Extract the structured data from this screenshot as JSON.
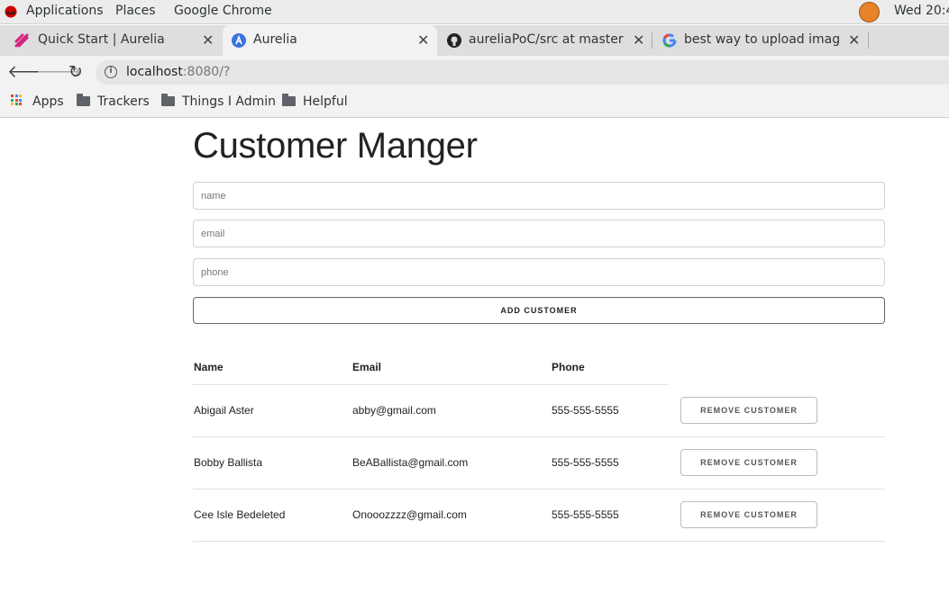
{
  "system": {
    "menus": [
      "Applications",
      "Places",
      "Google Chrome"
    ],
    "clock": "Wed 20:4"
  },
  "browser": {
    "tabs": [
      {
        "title": "Quick Start | Aurelia",
        "active": false
      },
      {
        "title": "Aurelia",
        "active": true
      },
      {
        "title": "aureliaPoC/src at master · jo",
        "active": false
      },
      {
        "title": "best way to upload image t",
        "active": false
      }
    ],
    "url": {
      "host": "localhost",
      "rest": ":8080/?"
    },
    "bookmarks": [
      "Apps",
      "Trackers",
      "Things I Admin",
      "Helpful"
    ]
  },
  "page": {
    "title": "Customer Manger",
    "form": {
      "name_placeholder": "name",
      "email_placeholder": "email",
      "phone_placeholder": "phone",
      "add_label": "ADD CUSTOMER"
    },
    "table": {
      "headers": [
        "Name",
        "Email",
        "Phone"
      ],
      "remove_label": "REMOVE CUSTOMER",
      "rows": [
        {
          "name": "Abigail Aster",
          "email": "abby@gmail.com",
          "phone": "555-555-5555"
        },
        {
          "name": "Bobby Ballista",
          "email": "BeABallista@gmail.com",
          "phone": "555-555-5555"
        },
        {
          "name": "Cee Isle Bedeleted",
          "email": "Onooozzzz@gmail.com",
          "phone": "555-555-5555"
        }
      ]
    }
  }
}
